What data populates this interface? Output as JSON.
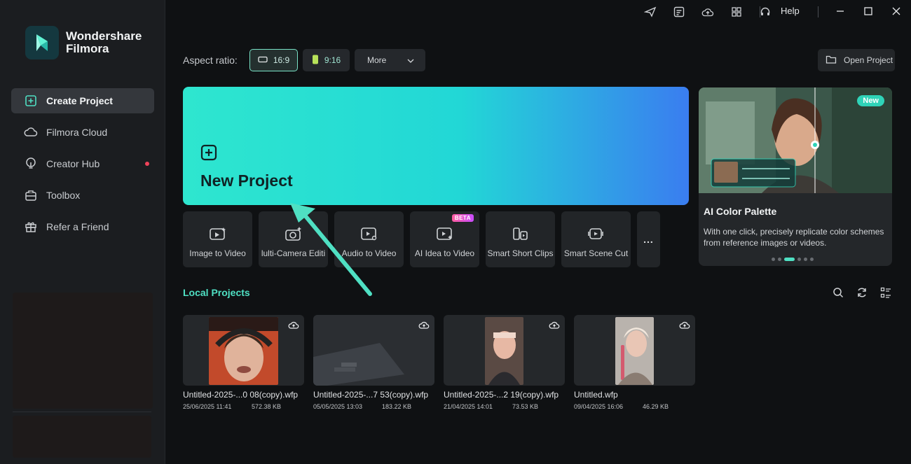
{
  "app": {
    "logo_line1": "Wondershare",
    "logo_line2": "Filmora"
  },
  "sidebar": {
    "items": [
      {
        "label": "Create Project",
        "icon": "plus-square-icon"
      },
      {
        "label": "Filmora Cloud",
        "icon": "cloud-icon"
      },
      {
        "label": "Creator Hub",
        "icon": "bulb-icon"
      },
      {
        "label": "Toolbox",
        "icon": "toolbox-icon"
      },
      {
        "label": "Refer a Friend",
        "icon": "gift-icon"
      }
    ]
  },
  "titlebar": {
    "help_label": "Help"
  },
  "aspect": {
    "label": "Aspect ratio:",
    "options": [
      "16:9",
      "9:16"
    ],
    "more_label": "More"
  },
  "open_project_label": "Open Project",
  "new_project": {
    "title": "New Project"
  },
  "tiles": [
    {
      "label": "Image to Video",
      "icon": "image-video-icon"
    },
    {
      "label": "lulti-Camera Editi",
      "icon": "multi-camera-icon"
    },
    {
      "label": "Audio to Video",
      "icon": "audio-video-icon"
    },
    {
      "label": "AI Idea to Video",
      "icon": "ai-idea-video-icon",
      "badge": "BETA"
    },
    {
      "label": "Smart Short Clips",
      "icon": "short-clips-icon"
    },
    {
      "label": "Smart Scene Cut",
      "icon": "scene-cut-icon"
    }
  ],
  "tiles_more": "...",
  "promo": {
    "badge": "New",
    "title": "AI Color Palette",
    "description": "With one click, precisely replicate color schemes from reference images or videos.",
    "slide_count": 6,
    "active_slide": 2
  },
  "local_projects": {
    "title": "Local Projects",
    "items": [
      {
        "name": "Untitled-2025-...0 08(copy).wfp",
        "date": "25/06/2025 11:41",
        "size": "572.38 KB"
      },
      {
        "name": "Untitled-2025-...7 53(copy).wfp",
        "date": "05/05/2025 13:03",
        "size": "183.22 KB"
      },
      {
        "name": "Untitled-2025-...2 19(copy).wfp",
        "date": "21/04/2025 14:01",
        "size": "73.53 KB"
      },
      {
        "name": "Untitled.wfp",
        "date": "09/04/2025 16:06",
        "size": "46.29 KB"
      }
    ]
  },
  "colors": {
    "accent": "#4fe0c3",
    "banner_start": "#2ee6cf",
    "banner_end": "#3a7df0",
    "sidebar_bg": "#1b1d20",
    "page_bg": "#0f1113"
  }
}
